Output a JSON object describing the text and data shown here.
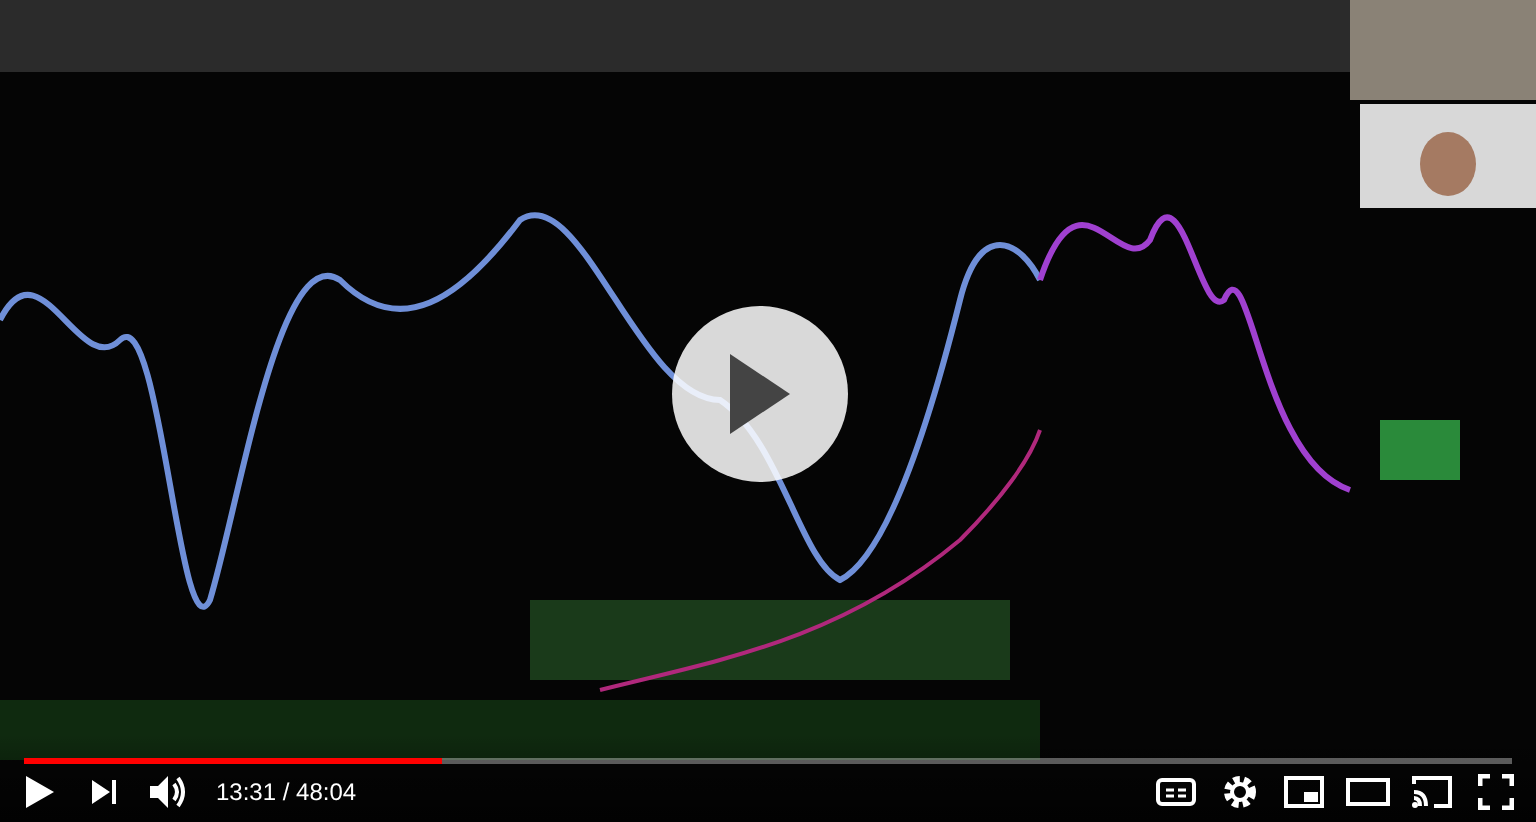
{
  "player": {
    "progress": {
      "level": 0.281
    },
    "time": "13:31 / 48:04"
  }
}
